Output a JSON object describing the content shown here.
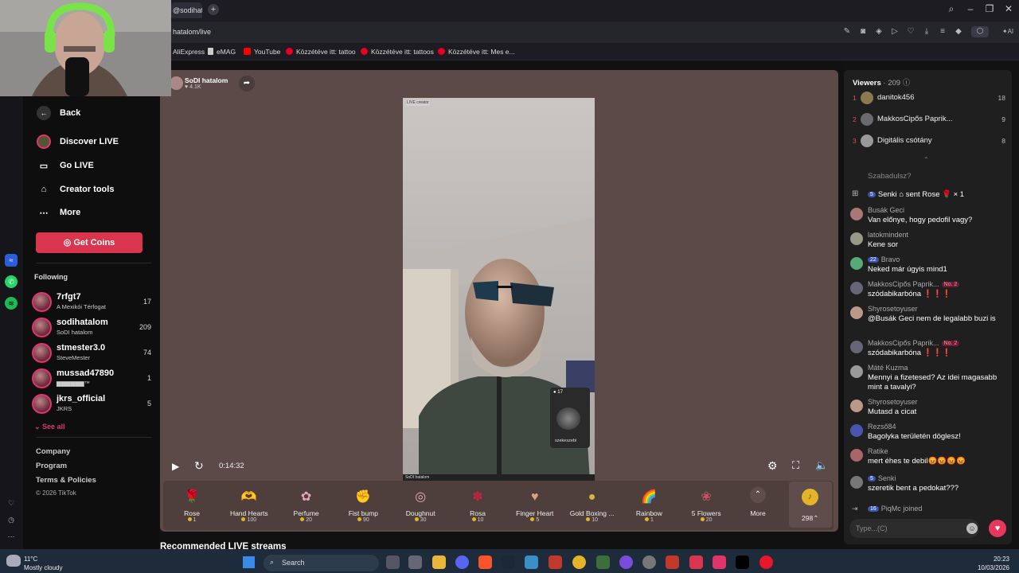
{
  "browser": {
    "tab_title": "@sodihata",
    "url": "hatalom/live",
    "bookmarks": [
      "AliExpress",
      "eMAG",
      "YouTube",
      "Közzétéve itt: tattoo",
      "Közzétéve itt: tattoos",
      "Közzétéve itt: Mes e..."
    ],
    "ai_label": "AI"
  },
  "sidebar": {
    "nav": [
      {
        "label": "Back",
        "icon": "arrow-left-icon"
      },
      {
        "label": "Discover LIVE",
        "icon": "live-avatar-icon"
      },
      {
        "label": "Go LIVE",
        "icon": "camera-icon"
      },
      {
        "label": "Creator tools",
        "icon": "home-icon"
      },
      {
        "label": "More",
        "icon": "more-dots-icon"
      }
    ],
    "get_coins": "Get Coins",
    "following_title": "Following",
    "following": [
      {
        "name": "7rfgt7",
        "sub": "A Mexikói Térfogat",
        "count": "17"
      },
      {
        "name": "sodihatalom",
        "sub": "SoDI hatalom",
        "count": "209"
      },
      {
        "name": "stmester3.0",
        "sub": "SteveMester",
        "count": "74"
      },
      {
        "name": "mussad47890",
        "sub": "▆▆▆▆▆▆™",
        "count": "1"
      },
      {
        "name": "jkrs_official",
        "sub": "JKRS",
        "count": "5"
      }
    ],
    "see_all": "See all",
    "footer": [
      "Company",
      "Program",
      "Terms & Policies"
    ],
    "copyright": "© 2026 TikTok"
  },
  "host": {
    "name": "SoDI hatalom",
    "likes": "4.1K"
  },
  "video": {
    "badge": "LIVE creator",
    "caption": "SoDI hatalom",
    "pip_count": "17",
    "pip_name": "szekeszebi"
  },
  "player": {
    "time": "0:14:32"
  },
  "gifts": [
    {
      "name": "Rose",
      "price": "1",
      "color": "#d92a3c",
      "glyph": "🌹"
    },
    {
      "name": "Hand Hearts",
      "price": "100",
      "color": "#e39bd6",
      "glyph": "🫶"
    },
    {
      "name": "Perfume",
      "price": "20",
      "color": "#e7a0c0",
      "glyph": "✿"
    },
    {
      "name": "Fist bump",
      "price": "90",
      "color": "#d98b6b",
      "glyph": "✊"
    },
    {
      "name": "Doughnut",
      "price": "30",
      "color": "#e8a8b6",
      "glyph": "◎"
    },
    {
      "name": "Rosa",
      "price": "10",
      "color": "#c8233a",
      "glyph": "✽"
    },
    {
      "name": "Finger Heart",
      "price": "5",
      "color": "#e0a088",
      "glyph": "♥"
    },
    {
      "name": "Gold Boxing ...",
      "price": "10",
      "color": "#d8b53b",
      "glyph": "●"
    },
    {
      "name": "Rainbow",
      "price": "1",
      "color": "#5fb0e0",
      "glyph": "🌈"
    },
    {
      "name": "5 Flowers",
      "price": "20",
      "color": "#c8506a",
      "glyph": "❀"
    }
  ],
  "gift_more": "More",
  "coin_balance": "298",
  "recommended": "Recommended LIVE streams",
  "chat": {
    "viewers_title": "Viewers",
    "viewers_count": "· 209",
    "top_viewers": [
      {
        "rank": "1",
        "name": "danitok456",
        "score": "18"
      },
      {
        "rank": "2",
        "name": "MakkosCipős Paprik...",
        "score": "9"
      },
      {
        "rank": "3",
        "name": "Digitális csótány",
        "score": "8"
      }
    ],
    "partial_text": "Szabadulsz?",
    "gift_event": {
      "level": "5",
      "user": "Senki",
      "text": "sent Rose",
      "times": "× 1"
    },
    "messages": [
      {
        "name": "Busák Geci",
        "text": "Van előnye, hogy pedofil vagy?"
      },
      {
        "name": "latokmindent",
        "text": "Kene sor"
      },
      {
        "name": "Bravo",
        "level": "22",
        "text": "Neked már úgyis mind1"
      },
      {
        "name": "MakkosCipős Paprik...",
        "badge": "No. 2",
        "text": "szódabikarbóna ❗❗❗"
      },
      {
        "name": "Shyrosetoyuser",
        "text": "@Busák Geci nem de legalabb buzi is"
      },
      {
        "name": "MakkosCipős Paprik...",
        "badge": "No. 2",
        "text": "szódabikarbóna ❗❗❗"
      },
      {
        "name": "Máté Kuzma",
        "text": "Mennyi a fizetesed? Az idei magasabb mint a tavalyi?"
      },
      {
        "name": "Shyrosetoyuser",
        "text": "Mutasd a cicat"
      },
      {
        "name": "Rezső84",
        "text": "Bagolyka területén döglesz!"
      },
      {
        "name": "Ratike",
        "text": "mert éhes te debil😡😡😡😡"
      },
      {
        "name": "Senki",
        "level": "5",
        "text": "szeretik bent a pedokat???"
      }
    ],
    "join_event": {
      "level": "16",
      "user": "PiqMc",
      "text": "joined"
    },
    "input_placeholder": "Type...(C)"
  },
  "taskbar": {
    "weather_temp": "11°C",
    "weather_desc": "Mostly cloudy",
    "search": "Search",
    "time": "20:23",
    "date": "10/03/2026"
  },
  "colors": {
    "accent": "#e0356a",
    "coins": "#d9354e"
  }
}
